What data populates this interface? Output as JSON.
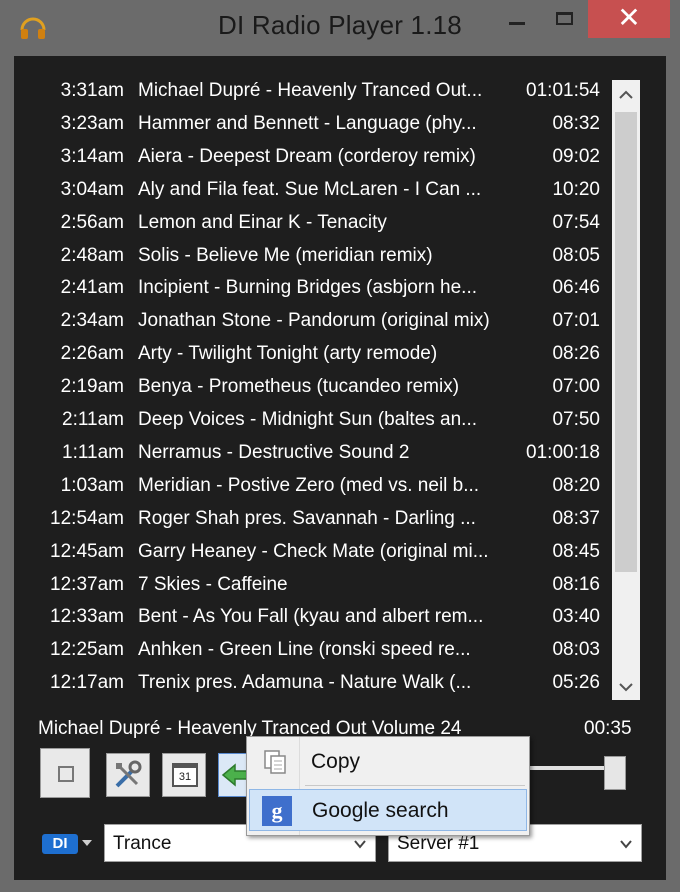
{
  "window": {
    "title": "DI Radio Player 1.18",
    "close_glyph": "✕"
  },
  "playlist": [
    {
      "time": "3:31am",
      "track": "Michael Dupré - Heavenly Tranced Out...",
      "duration": "01:01:54"
    },
    {
      "time": "3:23am",
      "track": "Hammer and Bennett - Language (phy...",
      "duration": "08:32"
    },
    {
      "time": "3:14am",
      "track": "Aiera - Deepest Dream (corderoy remix)",
      "duration": "09:02"
    },
    {
      "time": "3:04am",
      "track": "Aly and Fila feat. Sue McLaren - I Can ...",
      "duration": "10:20"
    },
    {
      "time": "2:56am",
      "track": "Lemon and Einar K - Tenacity",
      "duration": "07:54"
    },
    {
      "time": "2:48am",
      "track": "Solis - Believe Me (meridian remix)",
      "duration": "08:05"
    },
    {
      "time": "2:41am",
      "track": "Incipient - Burning Bridges (asbjorn he...",
      "duration": "06:46"
    },
    {
      "time": "2:34am",
      "track": "Jonathan Stone - Pandorum (original mix)",
      "duration": "07:01"
    },
    {
      "time": "2:26am",
      "track": "Arty - Twilight Tonight (arty remode)",
      "duration": "08:26"
    },
    {
      "time": "2:19am",
      "track": "Benya - Prometheus (tucandeo remix)",
      "duration": "07:00"
    },
    {
      "time": "2:11am",
      "track": "Deep Voices - Midnight Sun (baltes an...",
      "duration": "07:50"
    },
    {
      "time": "1:11am",
      "track": "Nerramus - Destructive Sound 2",
      "duration": "01:00:18"
    },
    {
      "time": "1:03am",
      "track": "Meridian - Postive Zero (med vs. neil b...",
      "duration": "08:20"
    },
    {
      "time": "12:54am",
      "track": "Roger Shah pres. Savannah - Darling ...",
      "duration": "08:37"
    },
    {
      "time": "12:45am",
      "track": "Garry Heaney - Check Mate (original mi...",
      "duration": "08:45"
    },
    {
      "time": "12:37am",
      "track": "7 Skies - Caffeine",
      "duration": "08:16"
    },
    {
      "time": "12:33am",
      "track": "Bent - As You Fall (kyau and albert rem...",
      "duration": "03:40"
    },
    {
      "time": "12:25am",
      "track": "Anhken - Green Line (ronski speed re...",
      "duration": "08:03"
    },
    {
      "time": "12:17am",
      "track": "Trenix pres. Adamuna - Nature Walk (...",
      "duration": "05:26"
    }
  ],
  "now_playing": {
    "track": "Michael Dupré - Heavenly Tranced Out Volume 24",
    "elapsed": "00:35"
  },
  "volume": 1.0,
  "calendar_icon_text": "31",
  "context_menu": {
    "copy_label": "Copy",
    "google_label": "Google search",
    "google_icon_text": "g"
  },
  "logo_text": "DI",
  "genre": {
    "selected": "Trance"
  },
  "server": {
    "selected": "Server #1"
  },
  "icons": [
    "headphones-icon",
    "minimize-icon",
    "maximize-icon",
    "close-icon",
    "scroll-up-icon",
    "scroll-down-icon",
    "stop-icon",
    "tools-icon",
    "calendar-icon",
    "favorite-icon",
    "copy-icon",
    "google-icon",
    "chevron-down-icon"
  ],
  "colors": {
    "titlebar": "#6b6b6b",
    "content_bg": "#1e1e1e",
    "close_button": "#c75050",
    "selection": "#d1e4f8",
    "accent_blue": "#1e6fd0"
  }
}
